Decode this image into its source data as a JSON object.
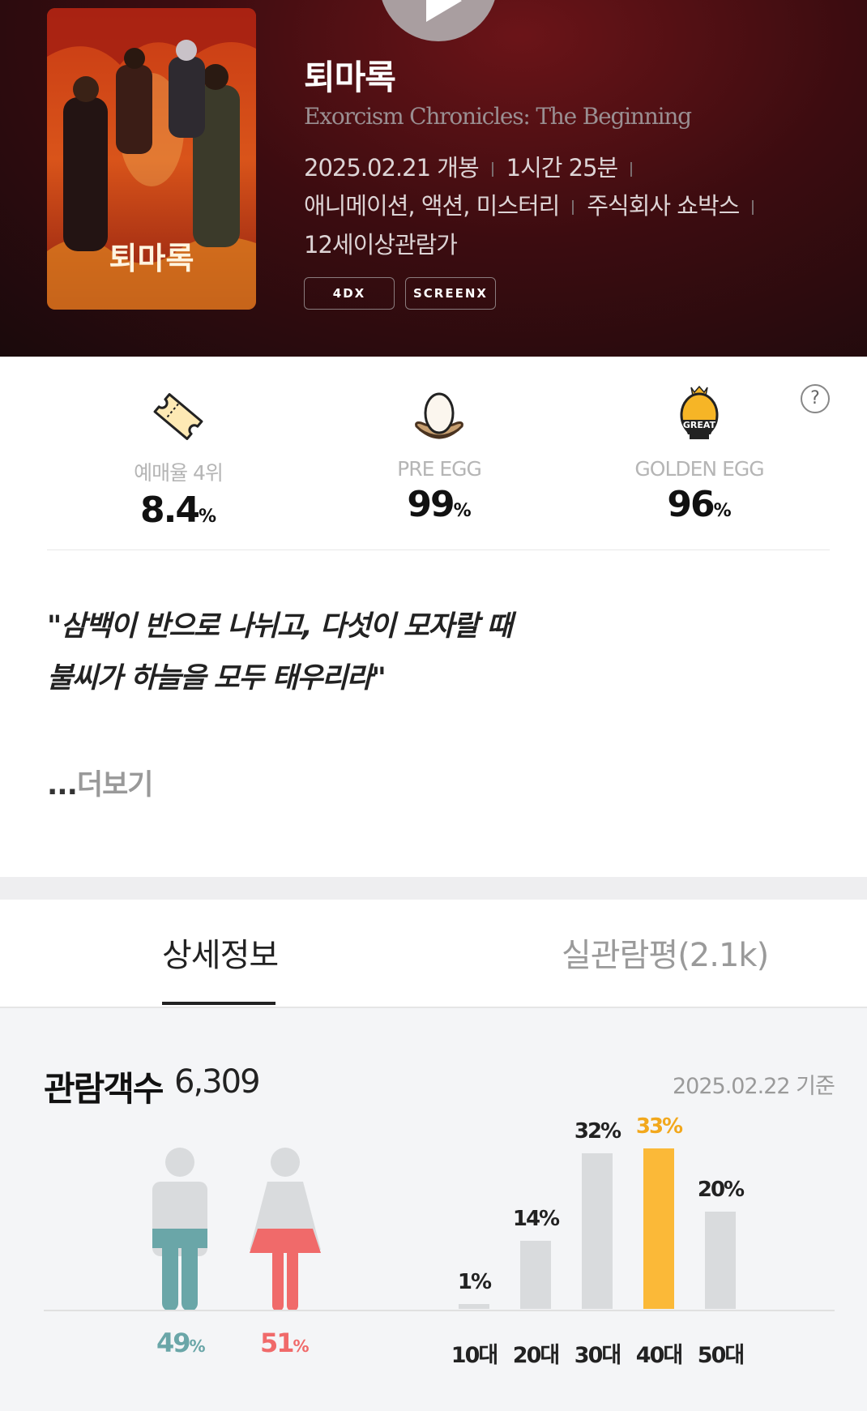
{
  "movie": {
    "title": "퇴마록",
    "original_title": "Exorcism Chronicles: The Beginning",
    "release": "2025.02.21 개봉",
    "runtime": "1시간 25분",
    "genre": "애니메이션, 액션, 미스터리",
    "distributor": "주식회사 쇼박스",
    "rating": "12세이상관람가",
    "formats": [
      "4DX",
      "SCREENX"
    ],
    "poster_title": "퇴마록"
  },
  "stats": {
    "booking": {
      "label": "예매율 4위",
      "value": "8.4",
      "unit": "%",
      "icon": "ticket-icon"
    },
    "pre_egg": {
      "label": "PRE EGG",
      "value": "99",
      "unit": "%",
      "icon": "egg-icon"
    },
    "golden_egg": {
      "label": "GOLDEN EGG",
      "value": "96",
      "unit": "%",
      "icon": "golden-egg-icon",
      "badge": "GREAT"
    },
    "help": "?"
  },
  "synopsis": {
    "line1": "\"삼백이 반으로 나뉘고, 다섯이 모자랄 때",
    "line2": "불씨가 하늘을 모두 태우리라\"",
    "more_dots": "...",
    "more_label": "더보기"
  },
  "tabs": [
    {
      "label": "상세정보",
      "active": true
    },
    {
      "label": "실관람평(2.1k)",
      "active": false
    }
  ],
  "audience": {
    "title": "관람객수",
    "count": "6,309",
    "date": "2025.02.22 기준",
    "gender": [
      {
        "name": "male",
        "value": "49",
        "unit": "%",
        "color": "#6aa6a8"
      },
      {
        "name": "female",
        "value": "51",
        "unit": "%",
        "color": "#f06a6a"
      }
    ]
  },
  "chart_data": {
    "type": "bar",
    "categories": [
      "10대",
      "20대",
      "30대",
      "40대",
      "50대"
    ],
    "values": [
      1,
      14,
      32,
      33,
      20
    ],
    "labels": [
      "1%",
      "14%",
      "32%",
      "33%",
      "20%"
    ],
    "highlight_index": 3,
    "colors": {
      "default": "#d9dbdd",
      "highlight": "#fbb938",
      "highlight_label": "#f2a81d"
    },
    "ylim": [
      0,
      33
    ],
    "title": "",
    "xlabel": "",
    "ylabel": ""
  }
}
